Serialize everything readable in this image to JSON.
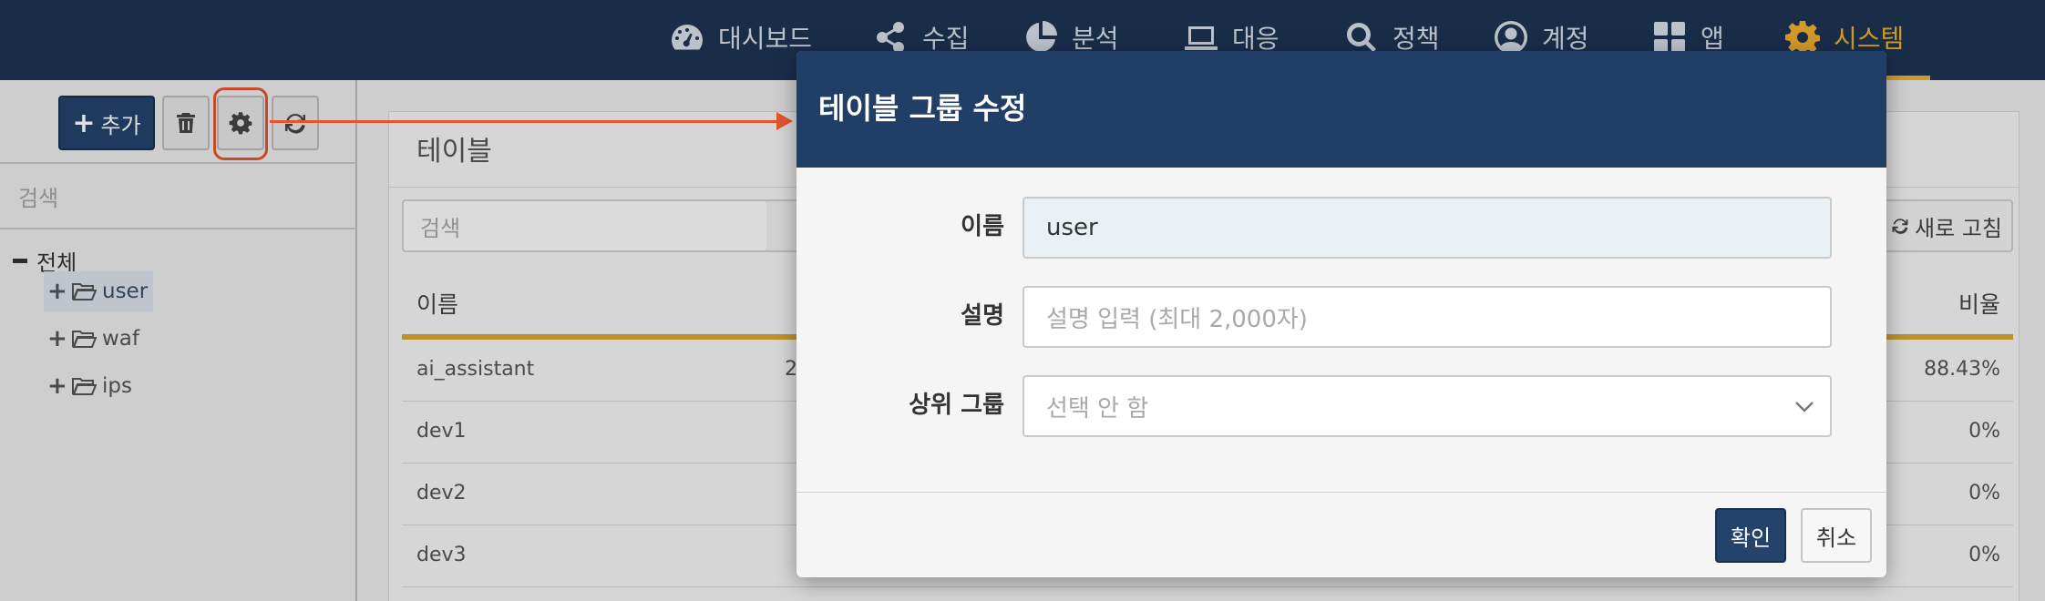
{
  "nav": {
    "items": [
      {
        "label": "대시보드",
        "icon": "dashboard-icon"
      },
      {
        "label": "수집",
        "icon": "share-icon"
      },
      {
        "label": "분석",
        "icon": "pie-chart-icon"
      },
      {
        "label": "대응",
        "icon": "laptop-icon"
      },
      {
        "label": "정책",
        "icon": "search-icon"
      },
      {
        "label": "계정",
        "icon": "user-circle-icon"
      },
      {
        "label": "앱",
        "icon": "grid-icon"
      },
      {
        "label": "시스템",
        "icon": "gear-icon"
      }
    ],
    "active_index": 7,
    "active_color": "#f0ad2e"
  },
  "sidebar": {
    "add_label": "추가",
    "search_placeholder": "검색",
    "tree": {
      "root_label": "전체",
      "nodes": [
        {
          "label": "user",
          "selected": true
        },
        {
          "label": "waf",
          "selected": false
        },
        {
          "label": "ips",
          "selected": false
        }
      ]
    }
  },
  "content": {
    "panel_title": "테이블",
    "search_placeholder": "검색",
    "refresh_label": "새로 고침",
    "table": {
      "columns": [
        "이름",
        "비율"
      ],
      "rows": [
        {
          "name": "ai_assistant",
          "extra": "2",
          "ratio": "88.43%"
        },
        {
          "name": "dev1",
          "extra": "",
          "ratio": "0%"
        },
        {
          "name": "dev2",
          "extra": "",
          "ratio": "0%"
        },
        {
          "name": "dev3",
          "extra": "",
          "ratio": "0%"
        }
      ]
    }
  },
  "modal": {
    "title": "테이블 그룹 수정",
    "fields": {
      "name_label": "이름",
      "name_value": "user",
      "description_label": "설명",
      "description_placeholder": "설명 입력 (최대 2,000자)",
      "parent_label": "상위 그룹",
      "parent_value": "선택 안 함"
    },
    "ok_label": "확인",
    "cancel_label": "취소"
  },
  "colors": {
    "nav_bg": "#1e3452",
    "primary": "#23436b",
    "highlight": "#e5532f",
    "table_accent": "#d9a534"
  }
}
